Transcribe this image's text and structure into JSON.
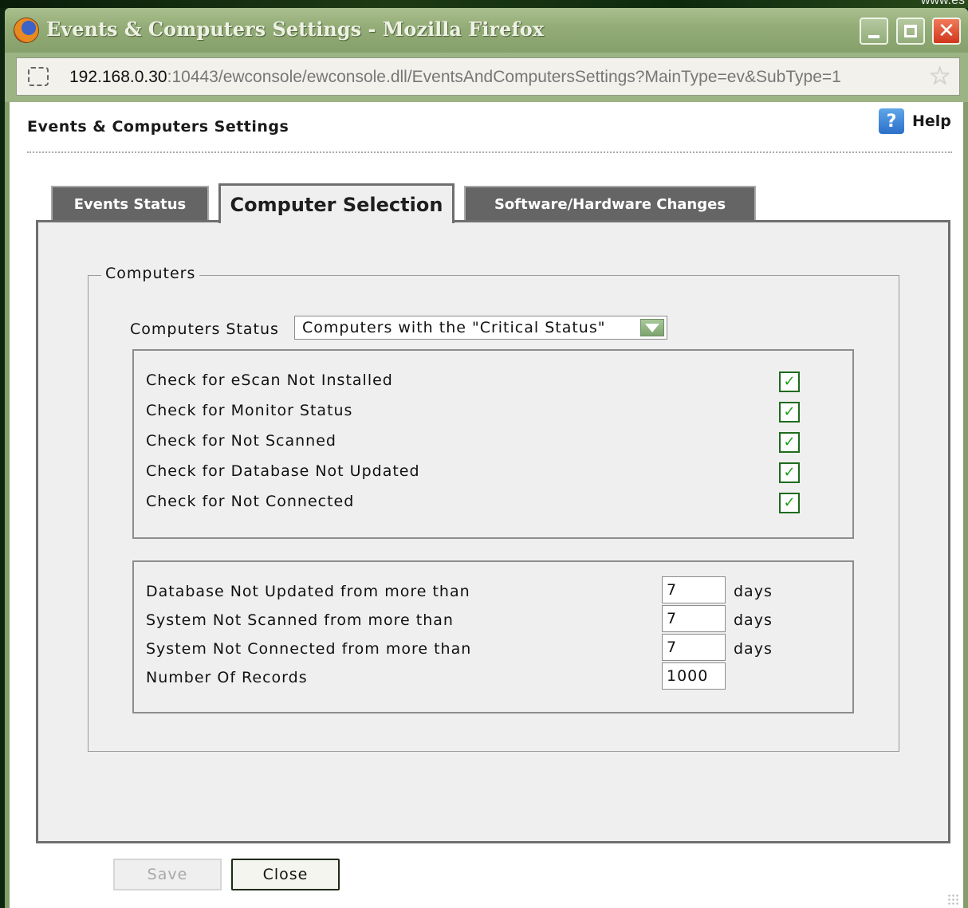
{
  "desktop": {
    "corner_text": "www.es"
  },
  "window": {
    "title": "Events & Computers Settings - Mozilla Firefox",
    "controls": {
      "minimize": "minimize",
      "maximize": "maximize",
      "close": "✕"
    }
  },
  "urlbar": {
    "host": "192.168.0.30",
    "path": ":10443/ewconsole/ewconsole.dll/EventsAndComputersSettings?MainType=ev&SubType=1"
  },
  "page": {
    "title": "Events & Computers Settings",
    "help_label": "Help",
    "help_glyph": "?"
  },
  "tabs": [
    {
      "label": "Events Status",
      "active": false
    },
    {
      "label": "Computer Selection",
      "active": true
    },
    {
      "label": "Software/Hardware Changes",
      "active": false
    }
  ],
  "computers": {
    "legend": "Computers",
    "status_label": "Computers Status",
    "status_value": "Computers with the \"Critical Status\"",
    "checks": [
      {
        "label": "Check for eScan Not Installed",
        "checked": true
      },
      {
        "label": "Check for Monitor Status",
        "checked": true
      },
      {
        "label": "Check for Not Scanned",
        "checked": true
      },
      {
        "label": "Check for Database Not Updated",
        "checked": true
      },
      {
        "label": "Check for Not Connected",
        "checked": true
      }
    ],
    "thresholds": [
      {
        "label": "Database Not Updated from more than",
        "value": "7",
        "unit": "days"
      },
      {
        "label": "System Not Scanned from more than",
        "value": "7",
        "unit": "days"
      },
      {
        "label": "System Not Connected from more than",
        "value": "7",
        "unit": "days"
      },
      {
        "label": "Number Of Records",
        "value": "1000",
        "unit": ""
      }
    ]
  },
  "buttons": {
    "save": "Save",
    "close": "Close"
  },
  "icons": {
    "checkmark": "✓",
    "site": "page-icon",
    "bookmark": "star-icon",
    "browser": "firefox-icon"
  },
  "colors": {
    "titlebar": "#94ad78",
    "tab_inactive": "#656565",
    "panel": "#efefef",
    "check_green": "#17a017"
  }
}
